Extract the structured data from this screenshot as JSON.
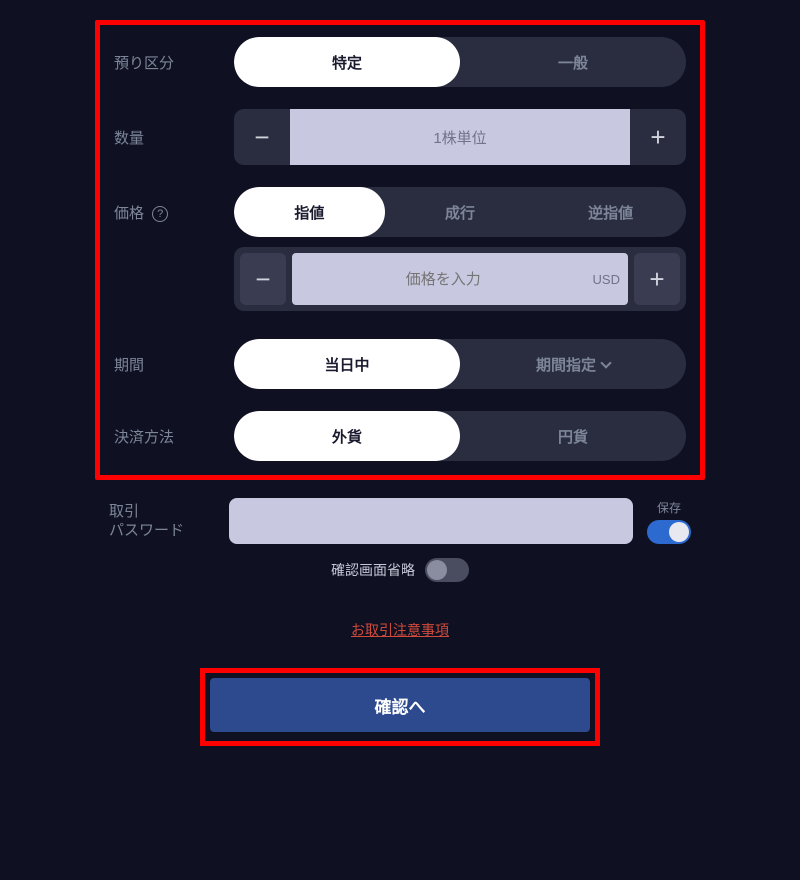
{
  "form": {
    "account_type": {
      "label": "預り区分",
      "options": {
        "specific": "特定",
        "general": "一般"
      }
    },
    "quantity": {
      "label": "数量",
      "placeholder": "1株単位"
    },
    "price": {
      "label": "価格",
      "help": "?",
      "options": {
        "limit": "指値",
        "market": "成行",
        "stop": "逆指値"
      },
      "placeholder": "価格を入力",
      "currency": "USD"
    },
    "period": {
      "label": "期間",
      "options": {
        "today": "当日中",
        "range": "期間指定"
      }
    },
    "settlement": {
      "label": "決済方法",
      "options": {
        "foreign": "外貨",
        "yen": "円貨"
      }
    }
  },
  "password": {
    "label_line1": "取引",
    "label_line2": "パスワード",
    "save_label": "保存"
  },
  "skip_confirm": {
    "label": "確認画面省略"
  },
  "footer": {
    "disclaimer": "お取引注意事項",
    "confirm": "確認へ"
  }
}
